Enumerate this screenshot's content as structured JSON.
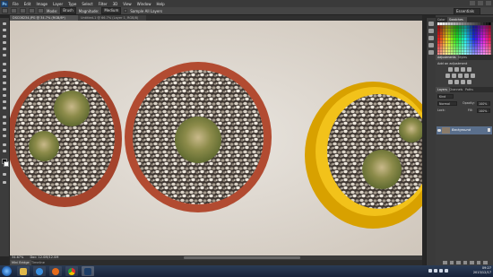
{
  "menu": {
    "app_icon": "Ps",
    "items": [
      "File",
      "Edit",
      "Image",
      "Layer",
      "Type",
      "Select",
      "Filter",
      "3D",
      "View",
      "Window",
      "Help"
    ]
  },
  "options_bar": {
    "mode_label": "Mode:",
    "mode_value": "Brush",
    "adjustment_label": "Magnitude:",
    "adjustment_value": "Medium",
    "ai_label": "Sample All Layers",
    "workspace": "Essentials"
  },
  "document": {
    "tab_active": "DSC08234.JPG @ 34.7% (RGB/8*)",
    "tab_inactive": "Untitled-1 @ 66.7% (Layer 1, RGB/8)",
    "status": "34.67%",
    "status_doc": "Doc: 12.0M/12.0M"
  },
  "mini_bridge": {
    "tab1": "Mini Bridge",
    "tab2": "Timeline"
  },
  "panels": {
    "color_tabs": [
      "Color",
      "Swatches"
    ],
    "adjust_tabs": [
      "Adjustments",
      "Styles"
    ],
    "adjust_title": "Add an adjustment",
    "layer_tabs": [
      "Layers",
      "Channels",
      "Paths"
    ],
    "kind_label": "Kind",
    "blend_mode": "Normal",
    "opacity_label": "Opacity:",
    "opacity_value": "100%",
    "lock_label": "Lock:",
    "fill_label": "Fill:",
    "fill_value": "100%",
    "layer_name": "Background"
  },
  "taskbar": {
    "time": "09:27",
    "date": "2013/12/17",
    "apps": [
      "explorer-icon",
      "ie-icon",
      "firefox-icon",
      "chrome-icon",
      "photoshop-icon"
    ]
  },
  "colors": {
    "accent": "#2d6fbf",
    "ps_blue": "#1c3d66",
    "pot_terracotta": "#a5442c",
    "pot_yellow": "#e8b300"
  }
}
